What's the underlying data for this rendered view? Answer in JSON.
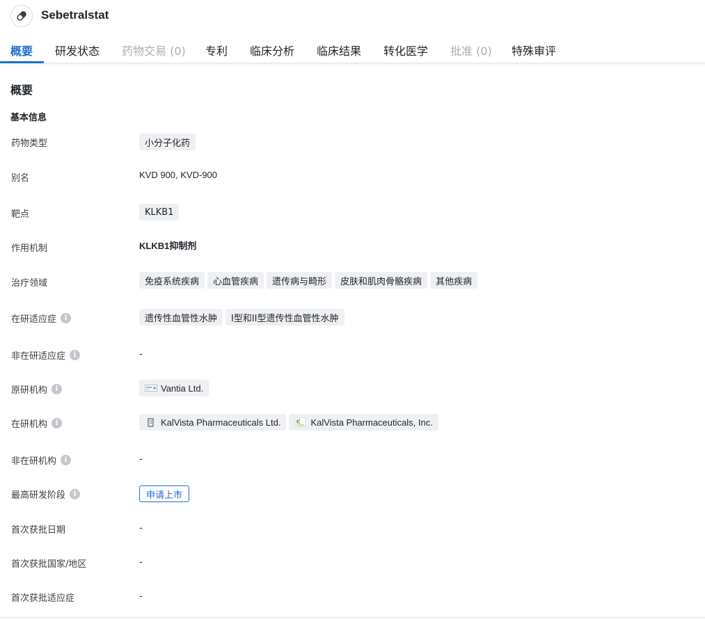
{
  "header": {
    "title": "Sebetralstat",
    "icon": "pill-icon"
  },
  "tabs": [
    {
      "label": "概要",
      "state": "active"
    },
    {
      "label": "研发状态",
      "state": "normal"
    },
    {
      "label": "药物交易 (0)",
      "state": "disabled"
    },
    {
      "label": "专利",
      "state": "normal"
    },
    {
      "label": "临床分析",
      "state": "normal"
    },
    {
      "label": "临床结果",
      "state": "normal"
    },
    {
      "label": "转化医学",
      "state": "normal"
    },
    {
      "label": "批准 (0)",
      "state": "disabled"
    },
    {
      "label": "特殊审评",
      "state": "normal"
    }
  ],
  "section": {
    "title": "概要",
    "subtitle": "基本信息"
  },
  "info": {
    "drug_type": {
      "label": "药物类型",
      "tags": [
        "小分子化药"
      ]
    },
    "aliases": {
      "label": "别名",
      "value": "KVD 900,  KVD-900"
    },
    "target": {
      "label": "靶点",
      "tags": [
        "KLKB1"
      ]
    },
    "mechanism": {
      "label": "作用机制",
      "value": "KLKB1抑制剂"
    },
    "therapeutic_areas": {
      "label": "治疗领域",
      "tags": [
        "免疫系统疾病",
        "心血管疾病",
        "遗传病与畸形",
        "皮肤和肌肉骨骼疾病",
        "其他疾病"
      ]
    },
    "active_indications": {
      "label": "在研适应症",
      "tags": [
        "遗传性血管性水肿",
        "I型和II型遗传性血管性水肿"
      ]
    },
    "inactive_indications": {
      "label": "非在研适应症",
      "value": "-"
    },
    "originator": {
      "label": "原研机构",
      "orgs": [
        {
          "name": "Vantia Ltd.",
          "logo": "vantia-logo-icon"
        }
      ]
    },
    "active_orgs": {
      "label": "在研机构",
      "orgs": [
        {
          "name": "KalVista Pharmaceuticals Ltd.",
          "logo": "building-icon"
        },
        {
          "name": "KalVista Pharmaceuticals, Inc.",
          "logo": "kalvista-logo-icon"
        }
      ]
    },
    "inactive_orgs": {
      "label": "非在研机构",
      "value": "-"
    },
    "highest_phase": {
      "label": "最高研发阶段",
      "badge": "申请上市",
      "badge_color": "#1e6fd0"
    },
    "first_approval_date": {
      "label": "首次获批日期",
      "value": "-"
    },
    "first_approval_country": {
      "label": "首次获批国家/地区",
      "value": "-"
    },
    "first_approval_indication": {
      "label": "首次获批适应症",
      "value": "-"
    }
  },
  "colors": {
    "accent": "#1e6fd0",
    "tag_bg": "#eef0f3",
    "disabled_text": "#a9adb5"
  }
}
